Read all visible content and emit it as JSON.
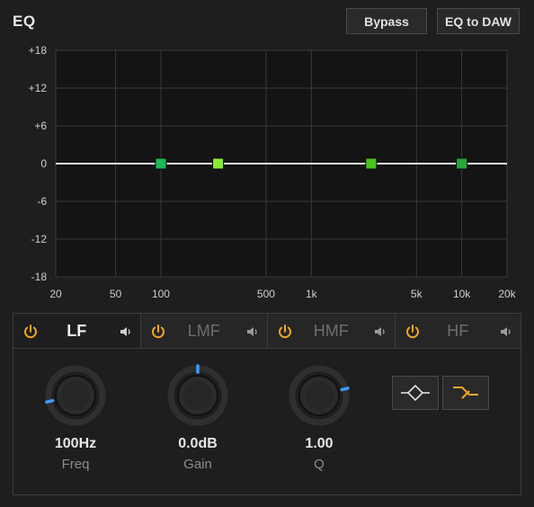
{
  "header": {
    "title": "EQ",
    "bypass_label": "Bypass",
    "eq_to_daw_label": "EQ to DAW"
  },
  "graph": {
    "db_labels": [
      "+18",
      "+12",
      "+6",
      "0",
      "-6",
      "-12",
      "-18"
    ],
    "db_values": [
      18,
      12,
      6,
      0,
      -6,
      -12,
      -18
    ],
    "freq_labels": [
      "20",
      "50",
      "100",
      "500",
      "1k",
      "5k",
      "10k",
      "20k"
    ],
    "freq_values": [
      20,
      50,
      100,
      500,
      1000,
      5000,
      10000,
      20000
    ],
    "band_points": [
      {
        "band": "LF",
        "freq": 100,
        "gain": 0,
        "color": "#1db954"
      },
      {
        "band": "LMF",
        "freq": 240,
        "gain": 0,
        "color": "#8be832"
      },
      {
        "band": "HMF",
        "freq": 2500,
        "gain": 0,
        "color": "#4cc21a"
      },
      {
        "band": "HF",
        "freq": 10000,
        "gain": 0,
        "color": "#27a83a"
      }
    ]
  },
  "tabs": [
    {
      "label": "LF",
      "active": true
    },
    {
      "label": "LMF",
      "active": false
    },
    {
      "label": "HMF",
      "active": false
    },
    {
      "label": "HF",
      "active": false
    }
  ],
  "knobs": [
    {
      "value": "100Hz",
      "label": "Freq",
      "position": 0.12
    },
    {
      "value": "0.0dB",
      "label": "Gain",
      "position": 0.5
    },
    {
      "value": "1.00",
      "label": "Q",
      "position": 0.78
    }
  ],
  "colors": {
    "accent": "#f5a623",
    "knob_marker": "#3c9bff",
    "curve": "#e6e6e6",
    "grid": "#3a3a3a"
  },
  "icons": {
    "power": "power-icon",
    "speaker": "speaker-icon",
    "bell_shape": "bell-filter-icon",
    "shelf_shape": "shelf-filter-icon"
  }
}
